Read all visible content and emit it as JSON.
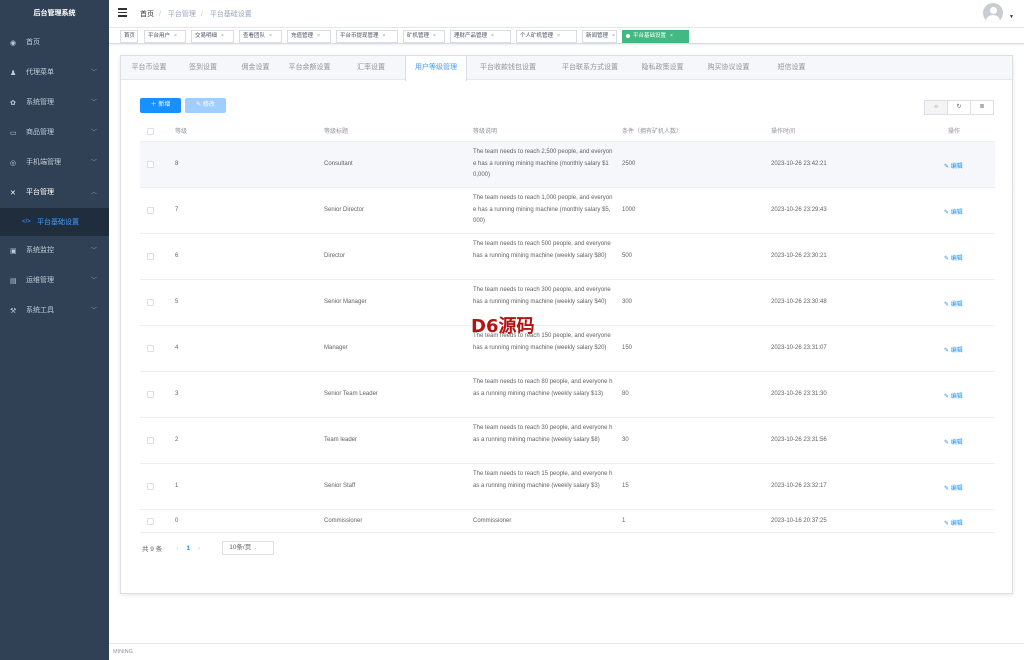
{
  "sidebar": {
    "title": "后台管理系统",
    "items": [
      {
        "label": "首页",
        "icon": "dashboard-icon"
      },
      {
        "label": "代理菜单",
        "icon": "user-icon"
      },
      {
        "label": "系统管理",
        "icon": "gear-icon"
      },
      {
        "label": "商品管理",
        "icon": "cart-icon"
      },
      {
        "label": "手机端管理",
        "icon": "phone-icon"
      },
      {
        "label": "平台管理",
        "icon": "tools-icon"
      },
      {
        "label": "系统监控",
        "icon": "monitor-icon"
      },
      {
        "label": "运维管理",
        "icon": "server-icon"
      },
      {
        "label": "系统工具",
        "icon": "wrench-icon"
      }
    ],
    "active_sub": "平台基础设置"
  },
  "breadcrumb": [
    "首页",
    "平台管理",
    "平台基础设置"
  ],
  "tags": [
    "首页",
    "平台用户",
    "交易明细",
    "查看团队",
    "充值管理",
    "平台币提现管理",
    "矿机管理",
    "理财产品管理",
    "个人矿机管理",
    "新闻管理",
    "平台基础设置"
  ],
  "tabs": [
    "平台币设置",
    "签到设置",
    "佣金设置",
    "平台余额设置",
    "汇率设置",
    "用户等级管理",
    "平台收款钱包设置",
    "平台联系方式设置",
    "隐私政策设置",
    "购买协议设置",
    "短信设置"
  ],
  "active_tab": "用户等级管理",
  "toolbar": {
    "add_label": "新增",
    "edit_label": "修改"
  },
  "table": {
    "headers": [
      "等级",
      "等级标题",
      "等级说明",
      "条件（拥有矿机人数）",
      "操作时间",
      "操作"
    ],
    "edit_label": "编辑",
    "rows": [
      {
        "level": "8",
        "title": "Consultant",
        "desc": "The team needs to reach 2,500 people, and everyone has a running mining machine (monthly salary $10,000)",
        "cond": "2500",
        "time": "2023-10-26 23:42:21"
      },
      {
        "level": "7",
        "title": "Senior Director",
        "desc": "The team needs to reach 1,000 people, and everyone has a running mining machine (monthly salary $5,000)",
        "cond": "1000",
        "time": "2023-10-26 23:29:43"
      },
      {
        "level": "6",
        "title": "Director",
        "desc": "The team needs to reach 500 people, and everyone has a running mining machine (weekly salary $80)",
        "cond": "500",
        "time": "2023-10-26 23:30:21"
      },
      {
        "level": "5",
        "title": "Senior Manager",
        "desc": "The team needs to reach 300 people, and everyone has a running mining machine (weekly salary $40)",
        "cond": "300",
        "time": "2023-10-26 23:30:48"
      },
      {
        "level": "4",
        "title": "Manager",
        "desc": "The team needs to reach 150 people, and everyone has a running mining machine (weekly salary $20)",
        "cond": "150",
        "time": "2023-10-26 23:31:07"
      },
      {
        "level": "3",
        "title": "Senior Team Leader",
        "desc": "The team needs to reach 80 people, and everyone has a running mining machine (weekly salary $13)",
        "cond": "80",
        "time": "2023-10-26 23:31:30"
      },
      {
        "level": "2",
        "title": "Team leader",
        "desc": "The team needs to reach 30 people, and everyone has a running mining machine (weekly salary $8)",
        "cond": "30",
        "time": "2023-10-26 23:31:56"
      },
      {
        "level": "1",
        "title": "Senior Staff",
        "desc": "The team needs to reach 15 people, and everyone has a running mining machine (weekly salary $3)",
        "cond": "15",
        "time": "2023-10-26 23:32:17"
      },
      {
        "level": "0",
        "title": "Commissioner",
        "desc": "Commissioner",
        "cond": "1",
        "time": "2023-10-16 20:37:25"
      }
    ]
  },
  "pagination": {
    "total": "共 9 条",
    "prev": "‹",
    "page": "1",
    "next": "›",
    "size": "10条/页"
  },
  "watermark": "D6源码",
  "footer": "MINING"
}
